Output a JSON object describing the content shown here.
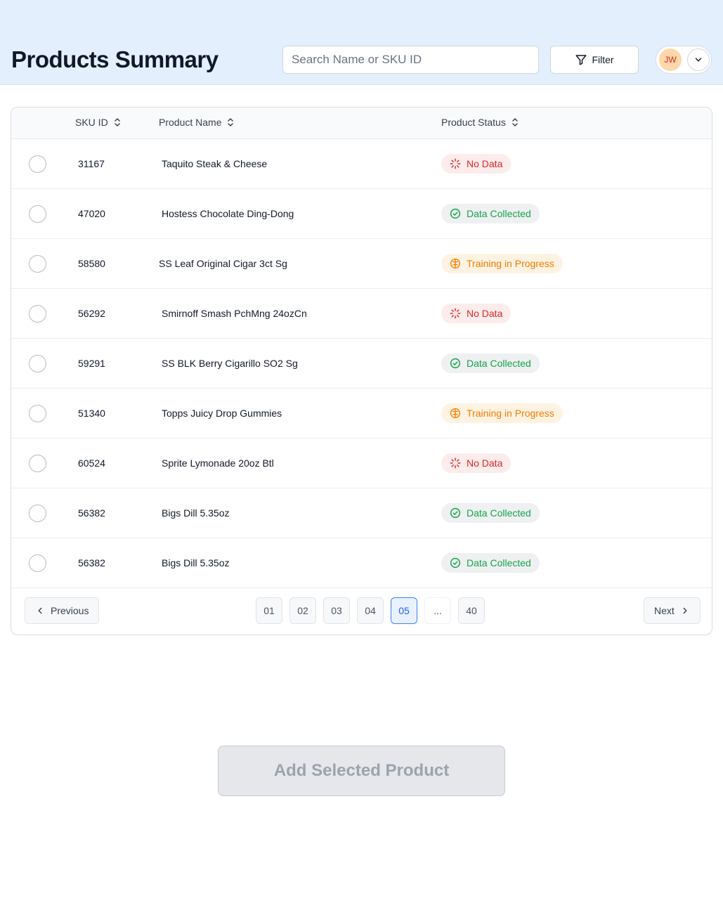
{
  "header": {
    "title": "Products Summary",
    "search_placeholder": "Search Name or SKU ID",
    "filter_label": "Filter",
    "user_initials": "JW"
  },
  "table": {
    "columns": [
      "SKU ID",
      "Product Name",
      "Product Status"
    ],
    "rows": [
      {
        "sku": "31167",
        "name": "Taquito Steak & Cheese",
        "status": "No Data",
        "status_kind": "nodata"
      },
      {
        "sku": "47020",
        "name": "Hostess Chocolate Ding-Dong",
        "status": "Data Collected",
        "status_kind": "collected"
      },
      {
        "sku": "58580",
        "name": "SS Leaf Original Cigar 3ct Sg",
        "status": "Training in Progress",
        "status_kind": "training"
      },
      {
        "sku": "56292",
        "name": "Smirnoff Smash PchMng 24ozCn",
        "status": "No Data",
        "status_kind": "nodata"
      },
      {
        "sku": "59291",
        "name": "SS BLK Berry Cigarillo SO2 Sg",
        "status": "Data Collected",
        "status_kind": "collected"
      },
      {
        "sku": "51340",
        "name": "Topps Juicy Drop Gummies",
        "status": "Training in Progress",
        "status_kind": "training"
      },
      {
        "sku": "60524",
        "name": "Sprite Lymonade 20oz Btl",
        "status": "No Data",
        "status_kind": "nodata"
      },
      {
        "sku": "56382",
        "name": "Bigs Dill 5.35oz",
        "status": "Data Collected",
        "status_kind": "collected"
      },
      {
        "sku": "56382",
        "name": "Bigs Dill 5.35oz",
        "status": "Data Collected",
        "status_kind": "collected"
      }
    ]
  },
  "pagination": {
    "previous_label": "Previous",
    "next_label": "Next",
    "pages": [
      "01",
      "02",
      "03",
      "04",
      "05",
      "...",
      "40"
    ],
    "current": "05"
  },
  "actions": {
    "add_selected_label": "Add Selected Product"
  },
  "colors": {
    "header_bg": "#e3effd",
    "no_data": "#dc2626",
    "data_collected": "#16a34a",
    "training": "#f57c00",
    "active_page": "#3b82f6"
  }
}
